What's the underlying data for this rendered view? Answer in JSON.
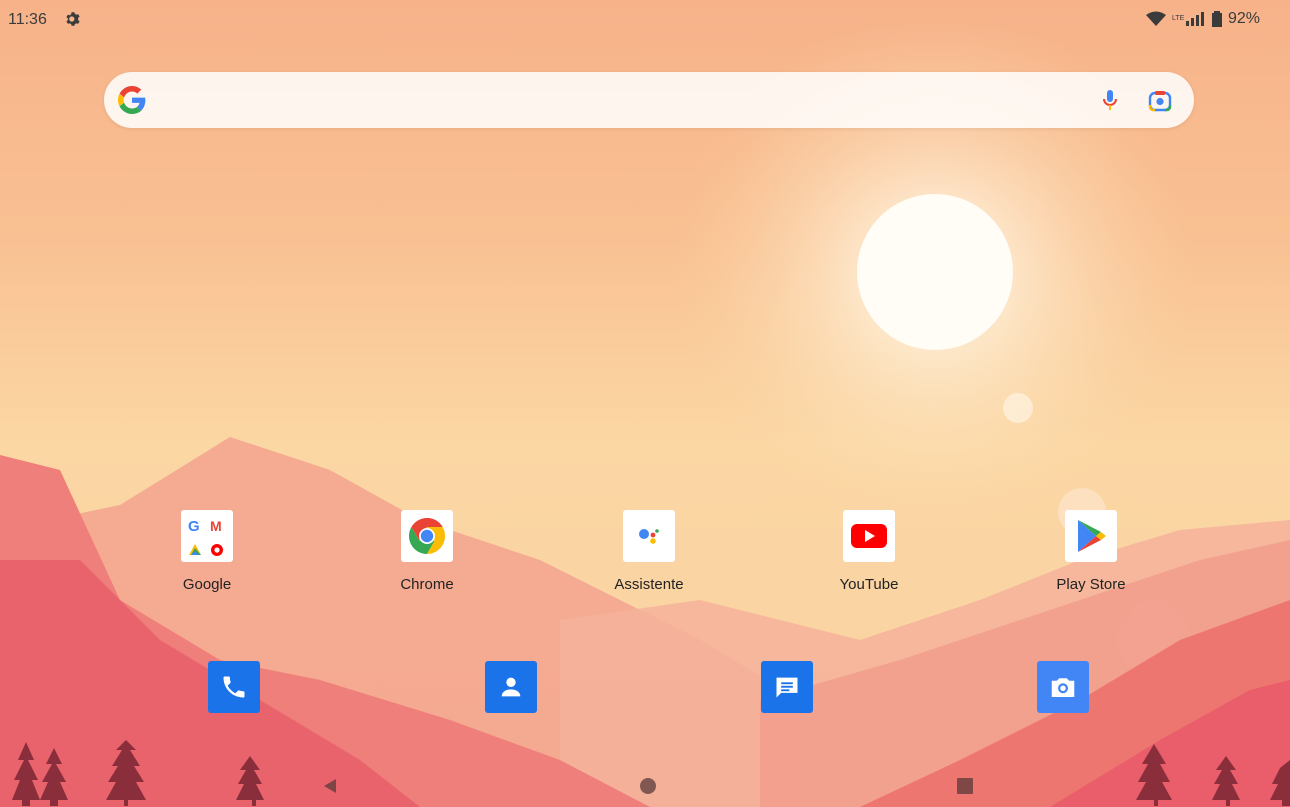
{
  "status_bar": {
    "time": "11:36",
    "battery": "92%",
    "icons": [
      "gear-icon",
      "wifi-icon",
      "lte-signal-icon",
      "battery-icon"
    ]
  },
  "search": {
    "icons": [
      "google-g-icon",
      "mic-icon",
      "lens-icon"
    ]
  },
  "apps": [
    {
      "label": "Google",
      "icon": "google-folder-icon"
    },
    {
      "label": "Chrome",
      "icon": "chrome-icon"
    },
    {
      "label": "Assistente",
      "icon": "assistant-icon"
    },
    {
      "label": "YouTube",
      "icon": "youtube-icon"
    },
    {
      "label": "Play Store",
      "icon": "play-store-icon"
    }
  ],
  "dock": [
    {
      "name": "phone",
      "icon": "phone-icon",
      "color": "#1a73e8"
    },
    {
      "name": "contacts",
      "icon": "contacts-icon",
      "color": "#1a73e8"
    },
    {
      "name": "messages",
      "icon": "messages-icon",
      "color": "#1a73e8"
    },
    {
      "name": "camera",
      "icon": "camera-icon",
      "color": "#4285f4"
    }
  ],
  "navigation": [
    "back-icon",
    "home-icon",
    "recents-icon"
  ],
  "colors": {
    "google_blue": "#4285F4",
    "google_red": "#EA4335",
    "google_yellow": "#FBBC05",
    "google_green": "#34A853",
    "youtube_red": "#FF0000"
  }
}
